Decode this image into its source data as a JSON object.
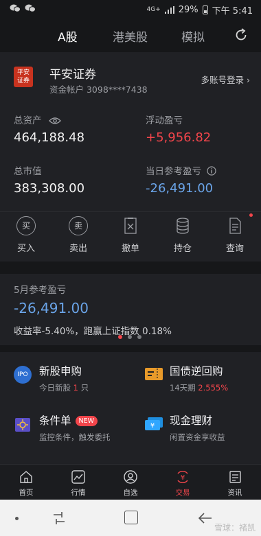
{
  "status_bar": {
    "network": "4G+",
    "battery": "29%",
    "time": "下午 5:41"
  },
  "top_tabs": [
    "A股",
    "港美股",
    "模拟"
  ],
  "account": {
    "logo_text": "平安\n证券",
    "broker": "平安证券",
    "account_label": "资金帐户 3098****7438",
    "multi_login": "多账号登录 ›"
  },
  "assets": {
    "total_label": "总资产",
    "total_value": "464,188.48",
    "float_label": "浮动盈亏",
    "float_value": "+5,956.82",
    "market_label": "总市值",
    "market_value": "383,308.00",
    "daily_label": "当日参考盈亏",
    "daily_value": "-26,491.00"
  },
  "actions": [
    {
      "icon": "buy-icon",
      "glyph": "买",
      "label": "买入"
    },
    {
      "icon": "sell-icon",
      "glyph": "卖",
      "label": "卖出"
    },
    {
      "icon": "cancel-order-icon",
      "label": "撤单"
    },
    {
      "icon": "holdings-icon",
      "label": "持仓"
    },
    {
      "icon": "query-icon",
      "label": "查询"
    }
  ],
  "monthly": {
    "label": "5月参考盈亏",
    "value": "-26,491.00",
    "detail": "收益率-5.40%，跑赢上证指数 0.18%"
  },
  "services": {
    "ipo": {
      "title": "新股申购",
      "sub_prefix": "今日新股",
      "sub_count": "1",
      "sub_suffix": "只",
      "icon_text": "IPO"
    },
    "repo": {
      "title": "国债逆回购",
      "sub_prefix": "14天期",
      "sub_rate": "2.555%"
    },
    "condition": {
      "title": "条件单",
      "badge": "NEW",
      "sub": "监控条件，触发委托"
    },
    "cash": {
      "title": "现金理财",
      "sub": "闲置资金享收益"
    }
  },
  "bottom_nav": [
    "首页",
    "行情",
    "自选",
    "交易",
    "资讯"
  ],
  "watermark": "雪球：褚凯",
  "colors": {
    "accent_red": "#f2454b",
    "accent_blue": "#6aa4e8",
    "bg": "#202125"
  }
}
